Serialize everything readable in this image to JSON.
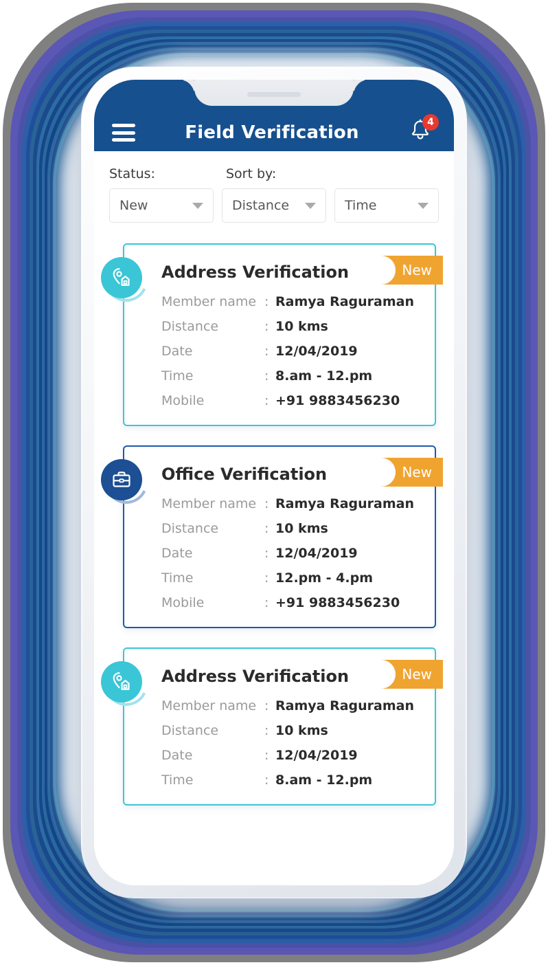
{
  "header": {
    "title": "Field Verification",
    "menu_icon": "hamburger-menu-icon",
    "bell_icon": "notification-bell-icon",
    "notification_count": "4"
  },
  "filters": {
    "status_label": "Status:",
    "sort_label": "Sort by:",
    "status_value": "New",
    "sort_distance_value": "Distance",
    "sort_time_value": "Time"
  },
  "colors": {
    "header_blue": "#16508f",
    "teal": "#3ac6d6",
    "office_blue": "#1c4f93",
    "ribbon_orange": "#f0a430",
    "badge_red": "#e8392f"
  },
  "cards": [
    {
      "title": "Address Verification",
      "icon": "location-pin-home-icon",
      "ribbon": "New",
      "rows": [
        {
          "key": "Member name",
          "sep": ":",
          "value": "Ramya Raguraman"
        },
        {
          "key": "Distance",
          "sep": ":",
          "value": "10 kms"
        },
        {
          "key": "Date",
          "sep": ":",
          "value": "12/04/2019"
        },
        {
          "key": "Time",
          "sep": ":",
          "value": "8.am - 12.pm"
        },
        {
          "key": "Mobile",
          "sep": ":",
          "value": "+91 9883456230"
        }
      ]
    },
    {
      "title": "Office Verification",
      "icon": "briefcase-icon",
      "ribbon": "New",
      "rows": [
        {
          "key": "Member name",
          "sep": ":",
          "value": "Ramya Raguraman"
        },
        {
          "key": "Distance",
          "sep": ":",
          "value": "10 kms"
        },
        {
          "key": "Date",
          "sep": ":",
          "value": "12/04/2019"
        },
        {
          "key": "Time",
          "sep": ":",
          "value": "12.pm - 4.pm"
        },
        {
          "key": "Mobile",
          "sep": ":",
          "value": "+91 9883456230"
        }
      ]
    },
    {
      "title": "Address Verification",
      "icon": "location-pin-home-icon",
      "ribbon": "New",
      "rows": [
        {
          "key": "Member name",
          "sep": ":",
          "value": "Ramya Raguraman"
        },
        {
          "key": "Distance",
          "sep": ":",
          "value": "10 kms"
        },
        {
          "key": "Date",
          "sep": ":",
          "value": "12/04/2019"
        },
        {
          "key": "Time",
          "sep": ":",
          "value": "8.am - 12.pm"
        }
      ]
    }
  ]
}
